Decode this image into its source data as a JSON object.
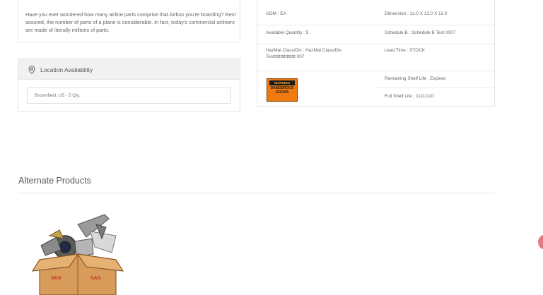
{
  "description": {
    "text": "Have you ever wondered how many airline parts comprise that Airbus you're boarding? Rest assured, the number of parts of a plane is considerable. In fact, today's commercial airliners are made of literally millions of parts."
  },
  "location": {
    "title": "Location Availability",
    "icon": "location-pin-icon",
    "value": "Broomfield, US - 5 Qty."
  },
  "specs": {
    "uom": "UOM : EA",
    "dimension": "Dimension : 12.0 X 12.0 X 12.0",
    "available_quantity": "Available Quantity : 5",
    "schedule_b": "Schedule B : Schedule B Test 0007",
    "hazmat_line1": "HazMat Class/Div : HazMat Class/Div",
    "hazmat_line2": "Testttttttttttttttttt 007",
    "lead_time": "Lead Time : STOCK",
    "remaining_shelf_life": "Remaining Shelf Life : Expired",
    "full_shelf_life": "Full Shelf Life : 11111110",
    "hazmat_label": {
      "warning": "WARNING",
      "line1": "DANGEROUS",
      "line2": "GOODS",
      "color": "#f07a10"
    }
  },
  "alternate_products": {
    "title": "Alternate Products",
    "items": [
      {
        "image": "parts-box-image",
        "box_brand": "SAS"
      }
    ]
  },
  "colors": {
    "accent_fab": "#e57a87"
  }
}
